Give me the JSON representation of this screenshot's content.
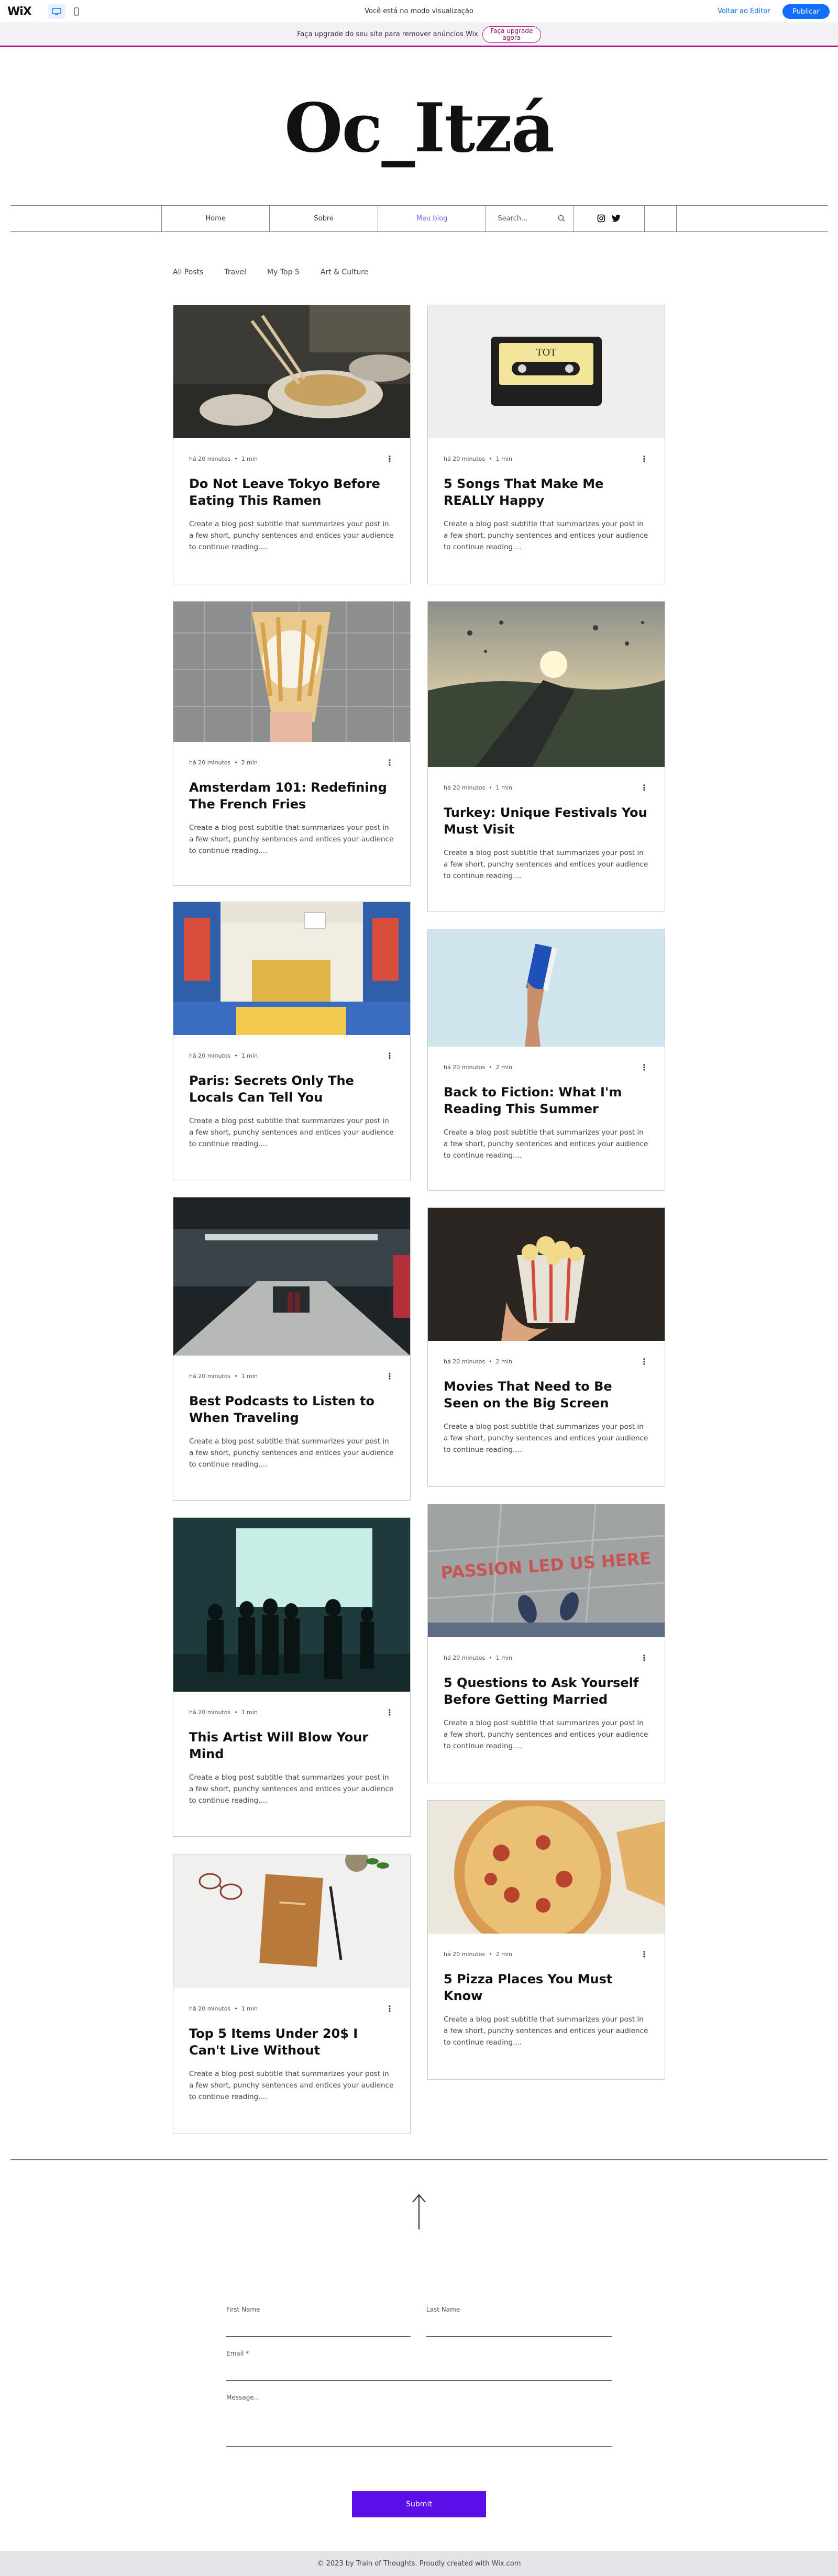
{
  "editor_bar": {
    "logo": "WiX",
    "message": "Você está no modo visualização",
    "back_label": "Voltar ao Editor",
    "publish_label": "Publicar"
  },
  "upgrade_bar": {
    "text": "Faça upgrade do seu site para remover anúncios Wix",
    "button_label": "Faça upgrade agora"
  },
  "site": {
    "title": "Oc_Itzá"
  },
  "nav": {
    "items": [
      "Home",
      "Sobre",
      "Meu blog"
    ],
    "active_index": 2,
    "search_placeholder": "Search..."
  },
  "categories": [
    "All Posts",
    "Travel",
    "My Top 5",
    "Art & Culture"
  ],
  "posts": [
    {
      "title": "Do Not Leave Tokyo Before Eating This Ramen",
      "age": "há 20 minutos",
      "read": "1 min",
      "excerpt": "Create a blog post subtitle that summarizes your post in a few short, punchy sentences and entices your audience to continue reading....",
      "image": "ramen-photo"
    },
    {
      "title": "5 Songs That Make Me REALLY Happy",
      "age": "há 20 minutos",
      "read": "1 min",
      "excerpt": "Create a blog post subtitle that summarizes your post in a few short, punchy sentences and entices your audience to continue reading....",
      "image": "cassette-photo"
    },
    {
      "title": "Amsterdam 101: Redefining The French Fries",
      "age": "há 20 minutos",
      "read": "2 min",
      "excerpt": "Create a blog post subtitle that summarizes your post in a few short, punchy sentences and entices your audience to continue reading....",
      "image": "fries-photo"
    },
    {
      "title": "Turkey: Unique Festivals You Must Visit",
      "age": "há 20 minutos",
      "read": "1 min",
      "excerpt": "Create a blog post subtitle that summarizes your post in a few short, punchy sentences and entices your audience to continue reading....",
      "image": "balloons-photo"
    },
    {
      "title": "Paris: Secrets Only The Locals Can Tell You",
      "age": "há 20 minutos",
      "read": "1 min",
      "excerpt": "Create a blog post subtitle that summarizes your post in a few short, punchy sentences and entices your audience to continue reading....",
      "image": "court-photo"
    },
    {
      "title": "Back to Fiction: What I'm Reading This Summer",
      "age": "há 20 minutos",
      "read": "2 min",
      "excerpt": "Create a blog post subtitle that summarizes your post in a few short, punchy sentences and entices your audience to continue reading....",
      "image": "book-hand-photo"
    },
    {
      "title": "Best Podcasts to Listen to When Traveling",
      "age": "há 20 minutos",
      "read": "1 min",
      "excerpt": "Create a blog post subtitle that summarizes your post in a few short, punchy sentences and entices your audience to continue reading....",
      "image": "subway-photo"
    },
    {
      "title": "Movies That Need to Be Seen on the Big Screen",
      "age": "há 20 minutos",
      "read": "2 min",
      "excerpt": "Create a blog post subtitle that summarizes your post in a few short, punchy sentences and entices your audience to continue reading....",
      "image": "popcorn-photo"
    },
    {
      "title": "This Artist Will Blow Your Mind",
      "age": "há 20 minutos",
      "read": "1 min",
      "excerpt": "Create a blog post subtitle that summarizes your post in a few short, punchy sentences and entices your audience to continue reading....",
      "image": "silhouettes-photo"
    },
    {
      "title": "5 Questions to Ask Yourself Before Getting Married",
      "age": "há 20 minutos",
      "read": "1 min",
      "excerpt": "Create a blog post subtitle that summarizes your post in a few short, punchy sentences and entices your audience to continue reading....",
      "image": "passion-photo",
      "image_text": "PASSION LED US HERE"
    },
    {
      "title": "Top 5 Items Under 20$ I Can't Live Without",
      "age": "há 20 minutos",
      "read": "1 min",
      "excerpt": "Create a blog post subtitle that summarizes your post in a few short, punchy sentences and entices your audience to continue reading....",
      "image": "notebook-photo"
    },
    {
      "title": "5 Pizza Places You Must Know",
      "age": "há 20 minutos",
      "read": "2 min",
      "excerpt": "Create a blog post subtitle that summarizes your post in a few short, punchy sentences and entices your audience to continue reading....",
      "image": "pizza-photo"
    }
  ],
  "form": {
    "first_name_label": "First Name",
    "last_name_label": "Last Name",
    "email_label": "Email *",
    "message_label": "Message...",
    "submit_label": "Submit"
  },
  "footer": {
    "text": "© 2023 by Train of Thoughts. Proudly created with Wix.com"
  },
  "colors": {
    "accent": "#116dff",
    "upgrade": "#b9178b",
    "submit": "#5b0ee8",
    "nav_active": "#7b5cff"
  },
  "icons": [
    "desktop-icon",
    "mobile-icon",
    "search-icon",
    "instagram-icon",
    "twitter-icon",
    "more-icon",
    "up-arrow-icon"
  ]
}
